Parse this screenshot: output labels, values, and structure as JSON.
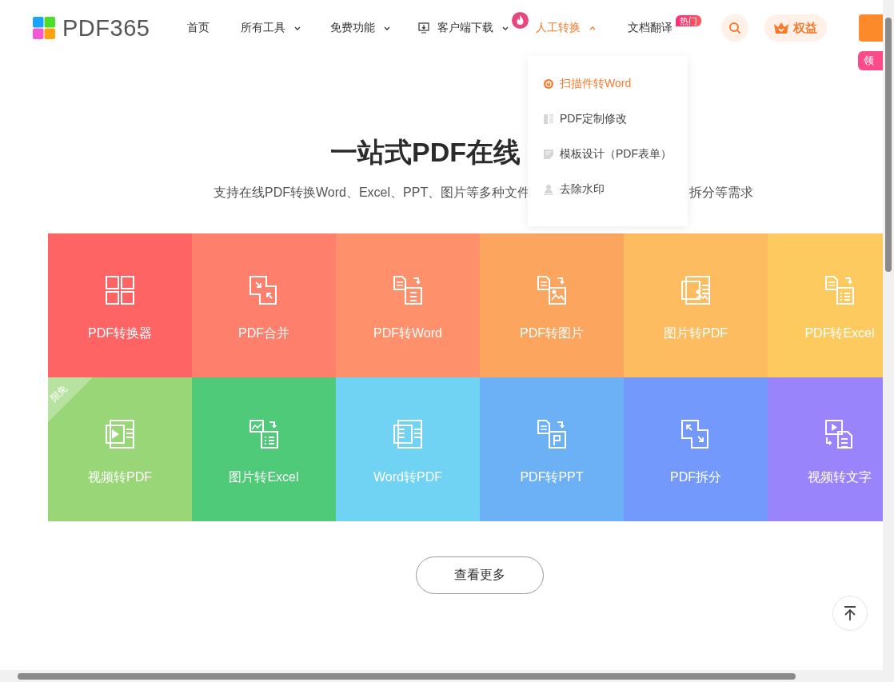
{
  "logo": {
    "text": "PDF365"
  },
  "nav": [
    {
      "label": "首页",
      "kind": "plain",
      "selected": false
    },
    {
      "label": "所有工具",
      "kind": "menu",
      "selected": false,
      "expanded": false
    },
    {
      "label": "免费功能",
      "kind": "menu",
      "selected": false,
      "expanded": false
    },
    {
      "label": "客户端下载",
      "kind": "download",
      "selected": false,
      "expanded": false
    },
    {
      "label": "人工转换",
      "kind": "hot",
      "selected": true,
      "expanded": true
    },
    {
      "label": "文档翻译",
      "kind": "plain",
      "selected": false,
      "badge": "热门"
    }
  ],
  "rights_button": {
    "label": "权益"
  },
  "side_badge": {
    "label": "领"
  },
  "dropdown": [
    {
      "label": "扫描件转Word",
      "selected": true
    },
    {
      "label": "PDF定制修改",
      "selected": false
    },
    {
      "label": "模板设计（PDF表单）",
      "selected": false
    },
    {
      "label": "去除水印",
      "selected": false
    }
  ],
  "hero": {
    "title": "一站式PDF在线",
    "subtitle_left": "支持在线PDF转换Word、Excel、PPT、图片等多种文件",
    "subtitle_right": "拆分等需求"
  },
  "tools": [
    {
      "label": "PDF转换器",
      "color": "#fe6464"
    },
    {
      "label": "PDF合并",
      "color": "#fe7f6b"
    },
    {
      "label": "PDF转Word",
      "color": "#fe916b"
    },
    {
      "label": "PDF转图片",
      "color": "#fca55e"
    },
    {
      "label": "图片转PDF",
      "color": "#fdbc60"
    },
    {
      "label": "PDF转Excel",
      "color": "#fdca5f"
    },
    {
      "label": "视频转PDF",
      "color": "#98d677",
      "badge": "限免"
    },
    {
      "label": "图片转Excel",
      "color": "#4eca78"
    },
    {
      "label": "Word转PDF",
      "color": "#70d3f3"
    },
    {
      "label": "PDF转PPT",
      "color": "#6cb1f6"
    },
    {
      "label": "PDF拆分",
      "color": "#7399fd"
    },
    {
      "label": "视频转文字",
      "color": "#9a84fc"
    }
  ],
  "more_button": {
    "label": "查看更多"
  }
}
